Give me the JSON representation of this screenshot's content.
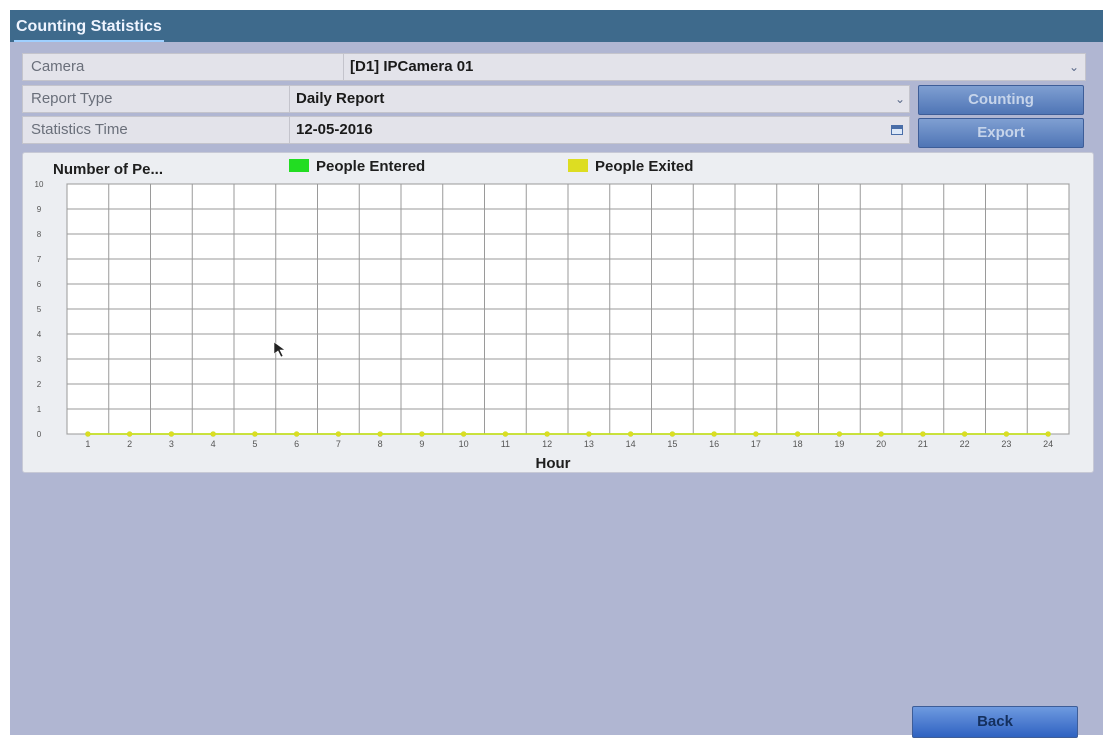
{
  "window": {
    "title": "Counting Statistics"
  },
  "form": {
    "camera": {
      "label": "Camera",
      "value": "[D1] IPCamera 01"
    },
    "report_type": {
      "label": "Report Type",
      "value": "Daily Report"
    },
    "statistics_time": {
      "label": "Statistics Time",
      "value": "12-05-2016"
    }
  },
  "buttons": {
    "counting": "Counting",
    "export": "Export",
    "back": "Back"
  },
  "icons": {
    "dropdown": "chevron-down-icon",
    "calendar": "calendar-icon",
    "cursor": "mouse-pointer-icon"
  },
  "chart_data": {
    "type": "line",
    "title": "Number of Pe...",
    "xlabel": "Hour",
    "ylabel": "",
    "ylim": [
      0,
      10
    ],
    "xlim": [
      1,
      24
    ],
    "grid": true,
    "legend_position": "top",
    "x": [
      1,
      2,
      3,
      4,
      5,
      6,
      7,
      8,
      9,
      10,
      11,
      12,
      13,
      14,
      15,
      16,
      17,
      18,
      19,
      20,
      21,
      22,
      23,
      24
    ],
    "yticks": [
      0,
      1,
      2,
      3,
      4,
      5,
      6,
      7,
      8,
      9,
      10
    ],
    "series": [
      {
        "name": "People Entered",
        "color": "#22dd22",
        "values": [
          0,
          0,
          0,
          0,
          0,
          0,
          0,
          0,
          0,
          0,
          0,
          0,
          0,
          0,
          0,
          0,
          0,
          0,
          0,
          0,
          0,
          0,
          0,
          0
        ]
      },
      {
        "name": "People Exited",
        "color": "#dddd22",
        "values": [
          0,
          0,
          0,
          0,
          0,
          0,
          0,
          0,
          0,
          0,
          0,
          0,
          0,
          0,
          0,
          0,
          0,
          0,
          0,
          0,
          0,
          0,
          0,
          0
        ]
      }
    ]
  }
}
